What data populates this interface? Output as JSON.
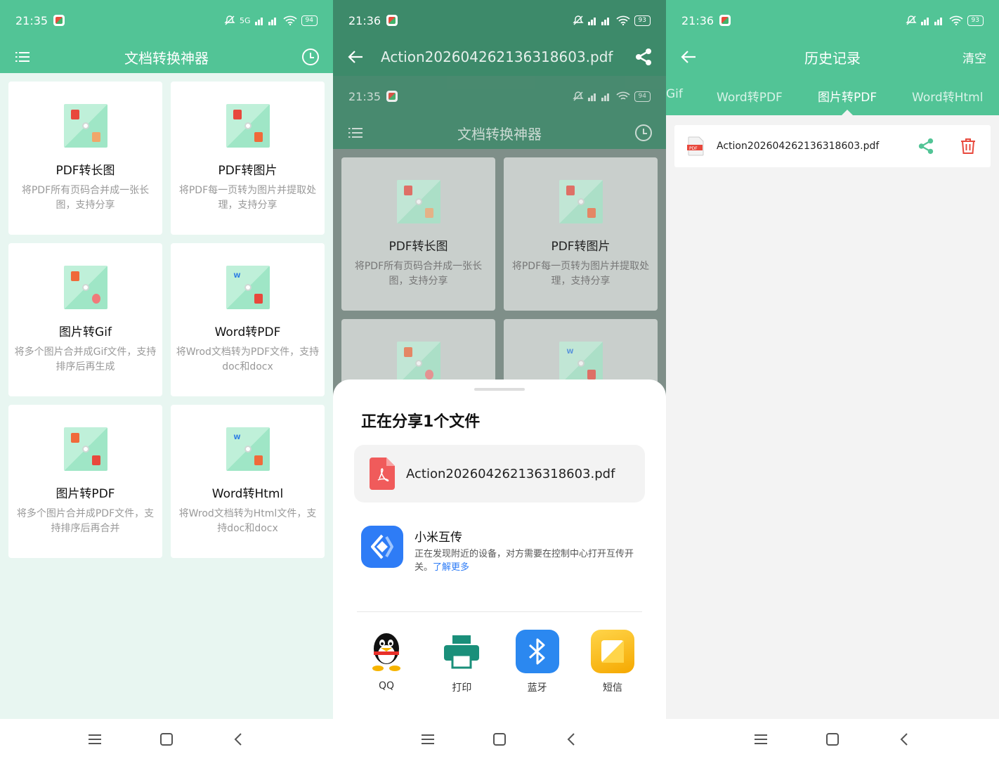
{
  "status": {
    "p1_time": "21:35",
    "p2_time": "21:36",
    "p2_inner_time": "21:35",
    "p3_time": "21:36",
    "p1_battery": "94",
    "p2_battery": "93",
    "p2_inner_battery": "94",
    "p3_battery": "93",
    "signal_label": "5G"
  },
  "app": {
    "title": "文档转换神器",
    "accent": "#52c496"
  },
  "features": [
    {
      "title": "PDF转长图",
      "desc": "将PDF所有页码合并成一张长图，支持分享"
    },
    {
      "title": "PDF转图片",
      "desc": "将PDF每一页转为图片并提取处理，支持分享"
    },
    {
      "title": "图片转Gif",
      "desc": "将多个图片合并成Gif文件，支持排序后再生成"
    },
    {
      "title": "Word转PDF",
      "desc": "将Wrod文档转为PDF文件，支持doc和docx"
    },
    {
      "title": "图片转PDF",
      "desc": "将多个图片合并成PDF文件，支持排序后再合并"
    },
    {
      "title": "Word转Html",
      "desc": "将Wrod文档转为Html文件，支持doc和docx"
    }
  ],
  "share": {
    "header_title": "Action202604262136318603.pdf",
    "sheet_title": "正在分享1个文件",
    "file_name": "Action202604262136318603.pdf",
    "mi_title": "小米互传",
    "mi_desc": "正在发现附近的设备，对方需要在控制中心打开互传开关。",
    "mi_link": "了解更多",
    "apps": [
      {
        "label": "QQ",
        "icon": "qq-icon"
      },
      {
        "label": "打印",
        "icon": "printer-icon"
      },
      {
        "label": "蓝牙",
        "icon": "bluetooth-icon"
      },
      {
        "label": "短信",
        "icon": "sms-icon"
      }
    ]
  },
  "history": {
    "title": "历史记录",
    "clear_label": "清空",
    "tabs": [
      "Gif",
      "Word转PDF",
      "图片转PDF",
      "Word转Html"
    ],
    "active_tab": "图片转PDF",
    "items": [
      {
        "name": "Action202604262136318603.pdf",
        "badge": "PDF"
      }
    ]
  }
}
